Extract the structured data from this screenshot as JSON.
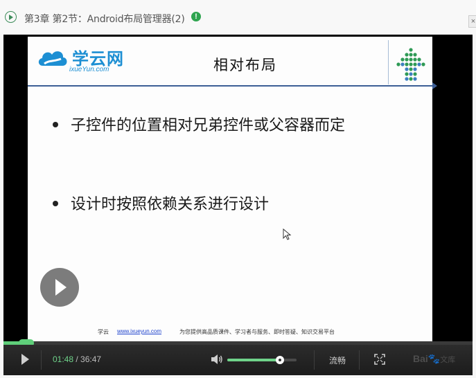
{
  "header": {
    "title": "第3章 第2节：Android布局管理器(2)",
    "badge": "!"
  },
  "slide": {
    "logo_text": "学云网",
    "logo_url": "ixueYun.com",
    "title": "相对布局",
    "bullets": [
      "子控件的位置相对兄弟控件或父容器而定",
      "设计时按照依赖关系进行设计"
    ],
    "footer": {
      "brand": "学云",
      "link": "www.ixueyun.com",
      "slogan": "为您提供高品质课件、学习者与服务、即时答疑、知识交易平台"
    }
  },
  "player": {
    "current_time": "01:48",
    "separator": " / ",
    "total_time": "36:47",
    "progress_percent": 4.9,
    "volume_percent": 76,
    "quality_label": "流畅",
    "watermark": "Bai",
    "watermark_sub": "文库",
    "colors": {
      "accent": "#5fcf7a",
      "background": "#000000"
    }
  }
}
